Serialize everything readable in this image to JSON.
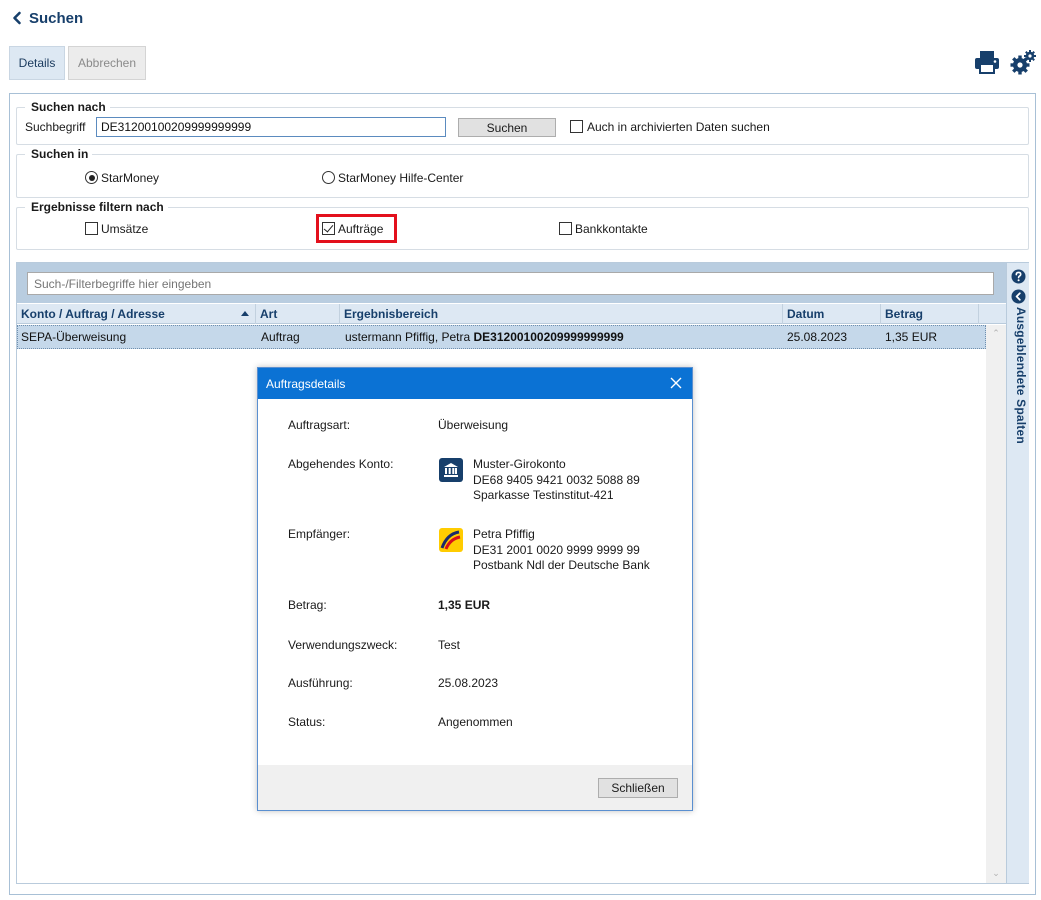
{
  "header": {
    "back_label": "Suchen"
  },
  "toolbar": {
    "details_label": "Details",
    "cancel_label": "Abbrechen"
  },
  "search_by": {
    "title": "Suchen nach",
    "term_label": "Suchbegriff",
    "term_value": "DE31200100209999999999",
    "search_button": "Suchen",
    "archive_label": "Auch in archivierten Daten suchen",
    "archive_checked": false
  },
  "search_in": {
    "title": "Suchen in",
    "options": [
      {
        "label": "StarMoney",
        "selected": true
      },
      {
        "label": "StarMoney Hilfe-Center",
        "selected": false
      }
    ]
  },
  "filter": {
    "title": "Ergebnisse filtern nach",
    "options": [
      {
        "label": "Umsätze",
        "checked": false
      },
      {
        "label": "Aufträge",
        "checked": true
      },
      {
        "label": "Bankkontakte",
        "checked": false
      }
    ]
  },
  "results": {
    "filter_placeholder": "Such-/Filterbegriffe hier eingeben",
    "columns": [
      "Konto / Auftrag / Adresse",
      "Art",
      "Ergebnisbereich",
      "Datum",
      "Betrag"
    ],
    "rows": [
      {
        "account": "SEPA-Überweisung",
        "type": "Auftrag",
        "area_prefix": "ustermann Pfiffig, Petra ",
        "area_bold": "DE31200100209999999999",
        "date": "25.08.2023",
        "amount": "1,35 EUR"
      }
    ],
    "hidden_columns_label": "Ausgeblendete Spalten"
  },
  "dialog": {
    "title": "Auftragsdetails",
    "order_type_label": "Auftragsart:",
    "order_type_value": "Überweisung",
    "from_label": "Abgehendes Konto:",
    "from_lines": [
      "Muster-Girokonto",
      "DE68 9405 9421 0032 5088 89",
      "Sparkasse Testinstitut-421"
    ],
    "to_label": "Empfänger:",
    "to_lines": [
      "Petra Pfiffig",
      "DE31 2001 0020 9999 9999 99",
      "Postbank Ndl der Deutsche Bank"
    ],
    "amount_label": "Betrag:",
    "amount_value": "1,35 EUR",
    "purpose_label": "Verwendungszweck:",
    "purpose_value": "Test",
    "execution_label": "Ausführung:",
    "execution_value": "25.08.2023",
    "status_label": "Status:",
    "status_value": "Angenommen",
    "close_button": "Schließen"
  },
  "colors": {
    "accent": "#0b72d4",
    "nav_text": "#173f6b",
    "highlight_border": "#e3101c",
    "selected_row": "#c5d8ea"
  }
}
